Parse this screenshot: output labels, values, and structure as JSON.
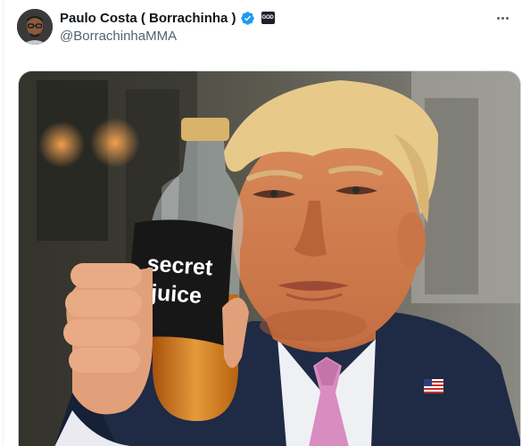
{
  "post": {
    "author": {
      "display_name": "Paulo Costa ( Borrachinha )",
      "handle": "@BorrachinhaMMA",
      "verified": true,
      "affiliate_badge_text": "GOD"
    },
    "more_icon": "more-horizontal-icon",
    "media": {
      "bottle_label": [
        "secret",
        "juice"
      ]
    }
  },
  "colors": {
    "verified_blue": "#1d9bf0",
    "name_text": "#0f1419",
    "secondary_text": "#536471"
  }
}
